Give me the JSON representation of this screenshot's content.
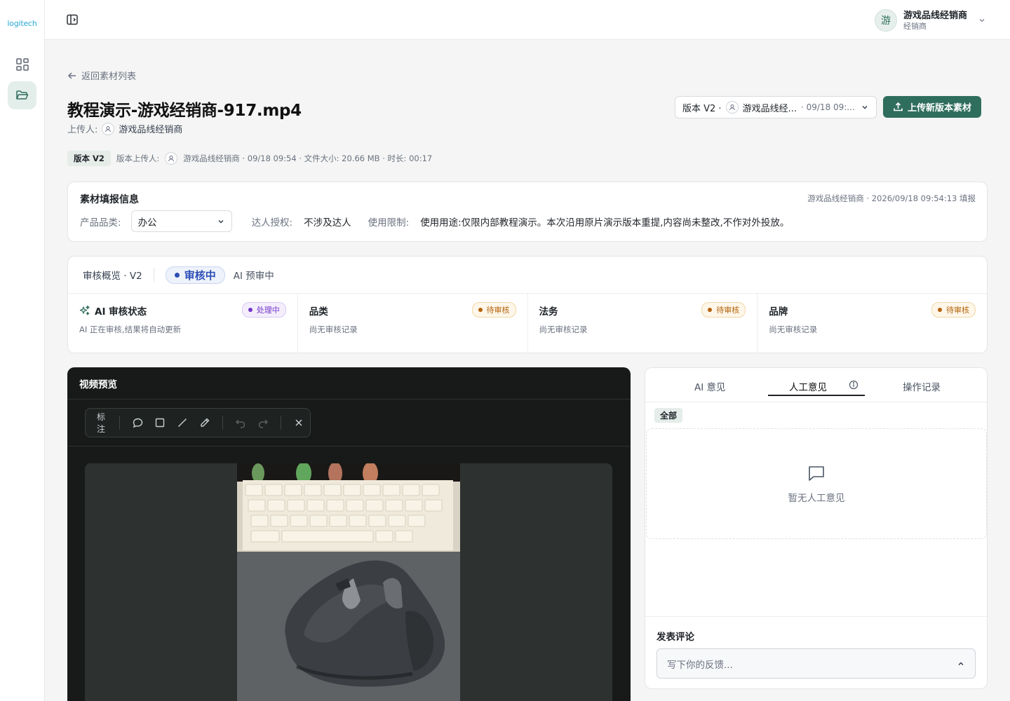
{
  "brand": {
    "logo_text": "logitech",
    "accent": "#2f6d5c"
  },
  "sidebar": {
    "items": [
      {
        "icon": "grid-icon"
      },
      {
        "icon": "folder-open-icon",
        "active": true
      }
    ]
  },
  "topbar": {
    "avatar_char": "游",
    "user_name": "游戏品线经销商",
    "user_role": "经销商"
  },
  "page": {
    "back_label": "返回素材列表",
    "title": "教程演示-游戏经销商-917.mp4",
    "uploader_label": "上传人:",
    "uploader_name": "游戏品线经销商",
    "version_select": {
      "version": "版本 V2 ·",
      "uploader": "游戏品线经...",
      "time": "· 09/18 09:..."
    },
    "upload_button": "上传新版本素材",
    "meta": {
      "version_badge": "版本 V2",
      "uploader_label": "版本上传人:",
      "details": "游戏品线经销商 · 09/18 09:54 · 文件大小: 20.66 MB · 时长: 00:17"
    }
  },
  "info": {
    "title": "素材填报信息",
    "submitted": "游戏品线经销商 · 2026/09/18 09:54:13 填报",
    "category_label": "产品品类:",
    "category_value": "办公",
    "talent_label": "达人授权:",
    "talent_value": "不涉及达人",
    "limit_label": "使用限制:",
    "limit_value": "使用用途:仅限内部教程演示。本次沿用原片演示版本重提,内容尚未整改,不作对外投放。"
  },
  "review": {
    "title": "审核概览 · V2",
    "status": "审核中",
    "ai_status": "AI 预审中",
    "columns": [
      {
        "title": "AI 审核状态",
        "badge": "处理中",
        "desc": "AI 正在审核,结果将自动更新"
      },
      {
        "title": "品类",
        "badge": "待审核",
        "desc": "尚无审核记录"
      },
      {
        "title": "法务",
        "badge": "待审核",
        "desc": "尚无审核记录"
      },
      {
        "title": "品牌",
        "badge": "待审核",
        "desc": "尚无审核记录"
      }
    ]
  },
  "video": {
    "title": "视频预览",
    "toolbar_label": "标注"
  },
  "comments": {
    "tabs": [
      "AI 意见",
      "人工意见",
      "操作记录"
    ],
    "filter_all": "全部",
    "empty_text": "暂无人工意见",
    "compose_title": "发表评论",
    "compose_placeholder": "写下你的反馈..."
  }
}
